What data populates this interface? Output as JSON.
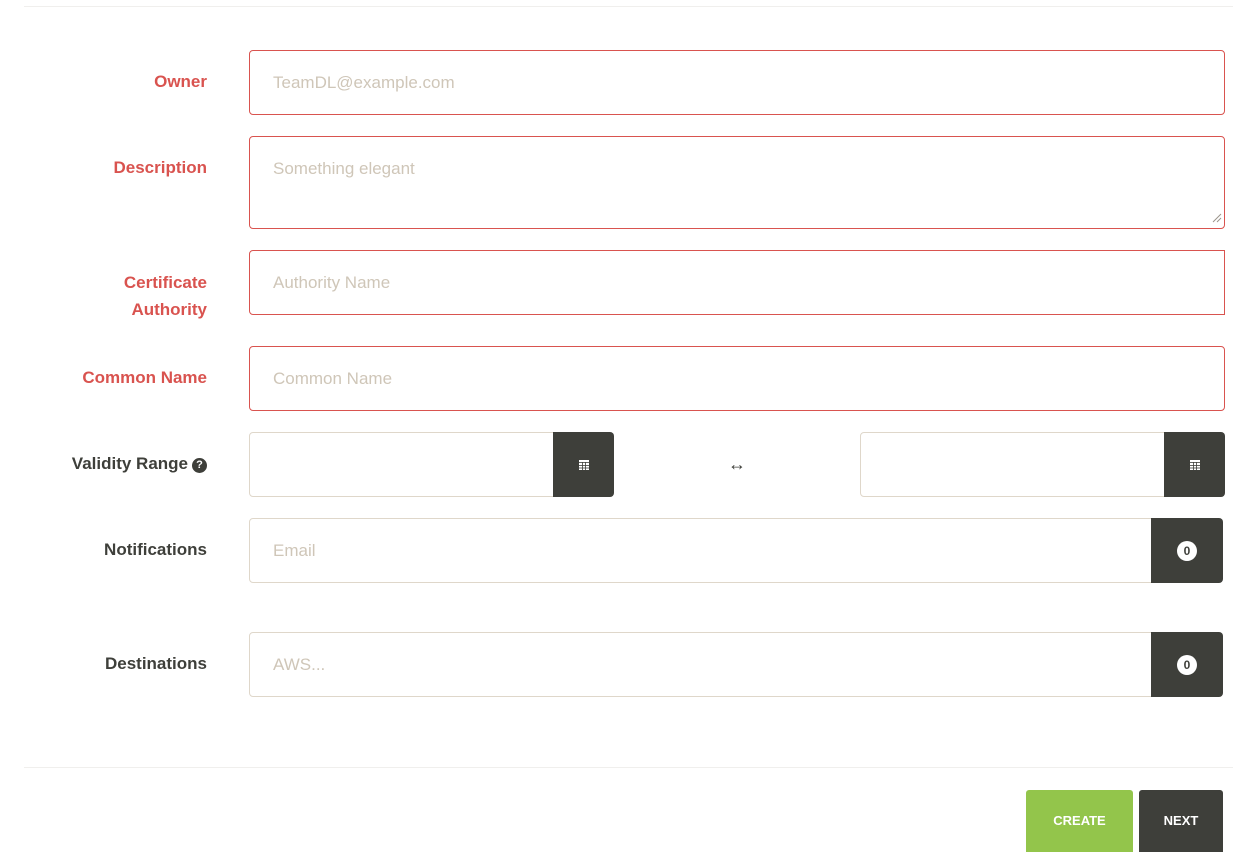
{
  "form": {
    "owner": {
      "label": "Owner",
      "placeholder": "TeamDL@example.com",
      "value": ""
    },
    "description": {
      "label": "Description",
      "placeholder": "Something elegant",
      "value": ""
    },
    "certificate_authority": {
      "label_line1": "Certificate",
      "label_line2": "Authority",
      "placeholder": "Authority Name",
      "value": ""
    },
    "common_name": {
      "label": "Common Name",
      "placeholder": "Common Name",
      "value": ""
    },
    "validity_range": {
      "label": "Validity Range",
      "help_icon": "question-circle-icon",
      "start_value": "",
      "end_value": "",
      "separator_icon": "left-right-arrow-icon",
      "calendar_icon": "calendar-icon"
    },
    "notifications": {
      "label": "Notifications",
      "placeholder": "Email",
      "value": "",
      "count": "0"
    },
    "destinations": {
      "label": "Destinations",
      "placeholder": "AWS...",
      "value": "",
      "count": "0"
    }
  },
  "footer": {
    "create_label": "CREATE",
    "next_label": "NEXT"
  },
  "colors": {
    "error": "#d9534f",
    "dark": "#3e3f3a",
    "success": "#93c54b",
    "border": "#dfd7ca",
    "placeholder": "#cfc6b8"
  }
}
